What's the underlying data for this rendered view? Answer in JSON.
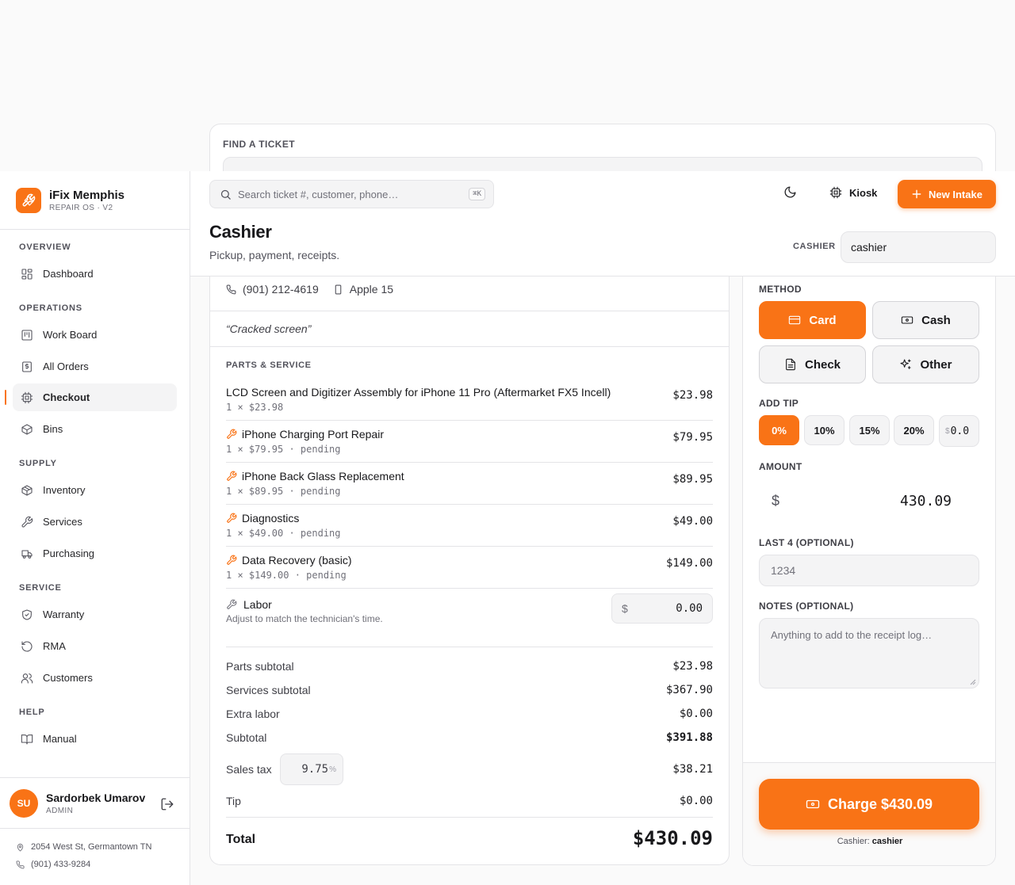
{
  "ghost": {
    "label": "FIND A TICKET"
  },
  "brand": {
    "name": "iFix Memphis",
    "sub": "REPAIR OS · V2"
  },
  "nav": {
    "overview": "OVERVIEW",
    "dashboard": "Dashboard",
    "operations": "OPERATIONS",
    "work_board": "Work Board",
    "all_orders": "All Orders",
    "checkout": "Checkout",
    "bins": "Bins",
    "supply": "SUPPLY",
    "inventory": "Inventory",
    "services": "Services",
    "purchasing": "Purchasing",
    "service": "SERVICE",
    "warranty": "Warranty",
    "rma": "RMA",
    "customers": "Customers",
    "help": "HELP",
    "manual": "Manual"
  },
  "user": {
    "initials": "SU",
    "name": "Sardorbek Umarov",
    "role": "ADMIN"
  },
  "store": {
    "address": "2054 West St, Germantown TN",
    "phone": "(901) 433-9284"
  },
  "topbar": {
    "search_placeholder": "Search ticket #, customer, phone…",
    "shortcut": "⌘K",
    "kiosk": "Kiosk",
    "new_intake": "New Intake"
  },
  "page": {
    "title": "Cashier",
    "subtitle": "Pickup, payment, receipts.",
    "cashier_label": "CASHIER",
    "cashier_value": "cashier"
  },
  "ticket": {
    "phone": "(901) 212-4619",
    "device": "Apple 15",
    "issue": "“Cracked screen”",
    "parts_label": "PARTS & SERVICE",
    "lines": [
      {
        "name": "LCD Screen and Digitizer Assembly for iPhone 11 Pro (Aftermarket FX5 Incell)",
        "meta": "1 × $23.98",
        "price": "$23.98",
        "service": false
      },
      {
        "name": "iPhone Charging Port Repair",
        "meta": "1 × $79.95 · pending",
        "price": "$79.95",
        "service": true
      },
      {
        "name": "iPhone Back Glass Replacement",
        "meta": "1 × $89.95 · pending",
        "price": "$89.95",
        "service": true
      },
      {
        "name": "Diagnostics",
        "meta": "1 × $49.00 · pending",
        "price": "$49.00",
        "service": true
      },
      {
        "name": "Data Recovery (basic)",
        "meta": "1 × $149.00 · pending",
        "price": "$149.00",
        "service": true
      }
    ],
    "labor": {
      "name": "Labor",
      "hint": "Adjust to match the technician's time.",
      "currency": "$",
      "value": "0.00"
    },
    "totals": {
      "parts_label": "Parts subtotal",
      "parts": "$23.98",
      "services_label": "Services subtotal",
      "services": "$367.90",
      "extra_label": "Extra labor",
      "extra": "$0.00",
      "subtotal_label": "Subtotal",
      "subtotal": "$391.88",
      "tax_label": "Sales tax",
      "tax_rate": "9.75",
      "tax_unit": "%",
      "tax": "$38.21",
      "tip_label": "Tip",
      "tip": "$0.00",
      "total_label": "Total",
      "total": "$430.09"
    }
  },
  "payment": {
    "method_label": "METHOD",
    "methods": {
      "card": "Card",
      "cash": "Cash",
      "check": "Check",
      "other": "Other"
    },
    "tip_label": "ADD TIP",
    "tips": {
      "t0": "0%",
      "t10": "10%",
      "t15": "15%",
      "t20": "20%",
      "custom_currency": "$",
      "custom_value": "0.0"
    },
    "amount_label": "AMOUNT",
    "amount_currency": "$",
    "amount": "430.09",
    "last4_label": "LAST 4 (OPTIONAL)",
    "last4_placeholder": "1234",
    "notes_label": "NOTES (OPTIONAL)",
    "notes_placeholder": "Anything to add to the receipt log…",
    "charge": "Charge $430.09",
    "cashier_prefix": "Cashier:",
    "cashier_name": "cashier"
  },
  "colors": {
    "accent": "#f97316",
    "border": "#e4e4e7",
    "muted": "#71717a"
  }
}
